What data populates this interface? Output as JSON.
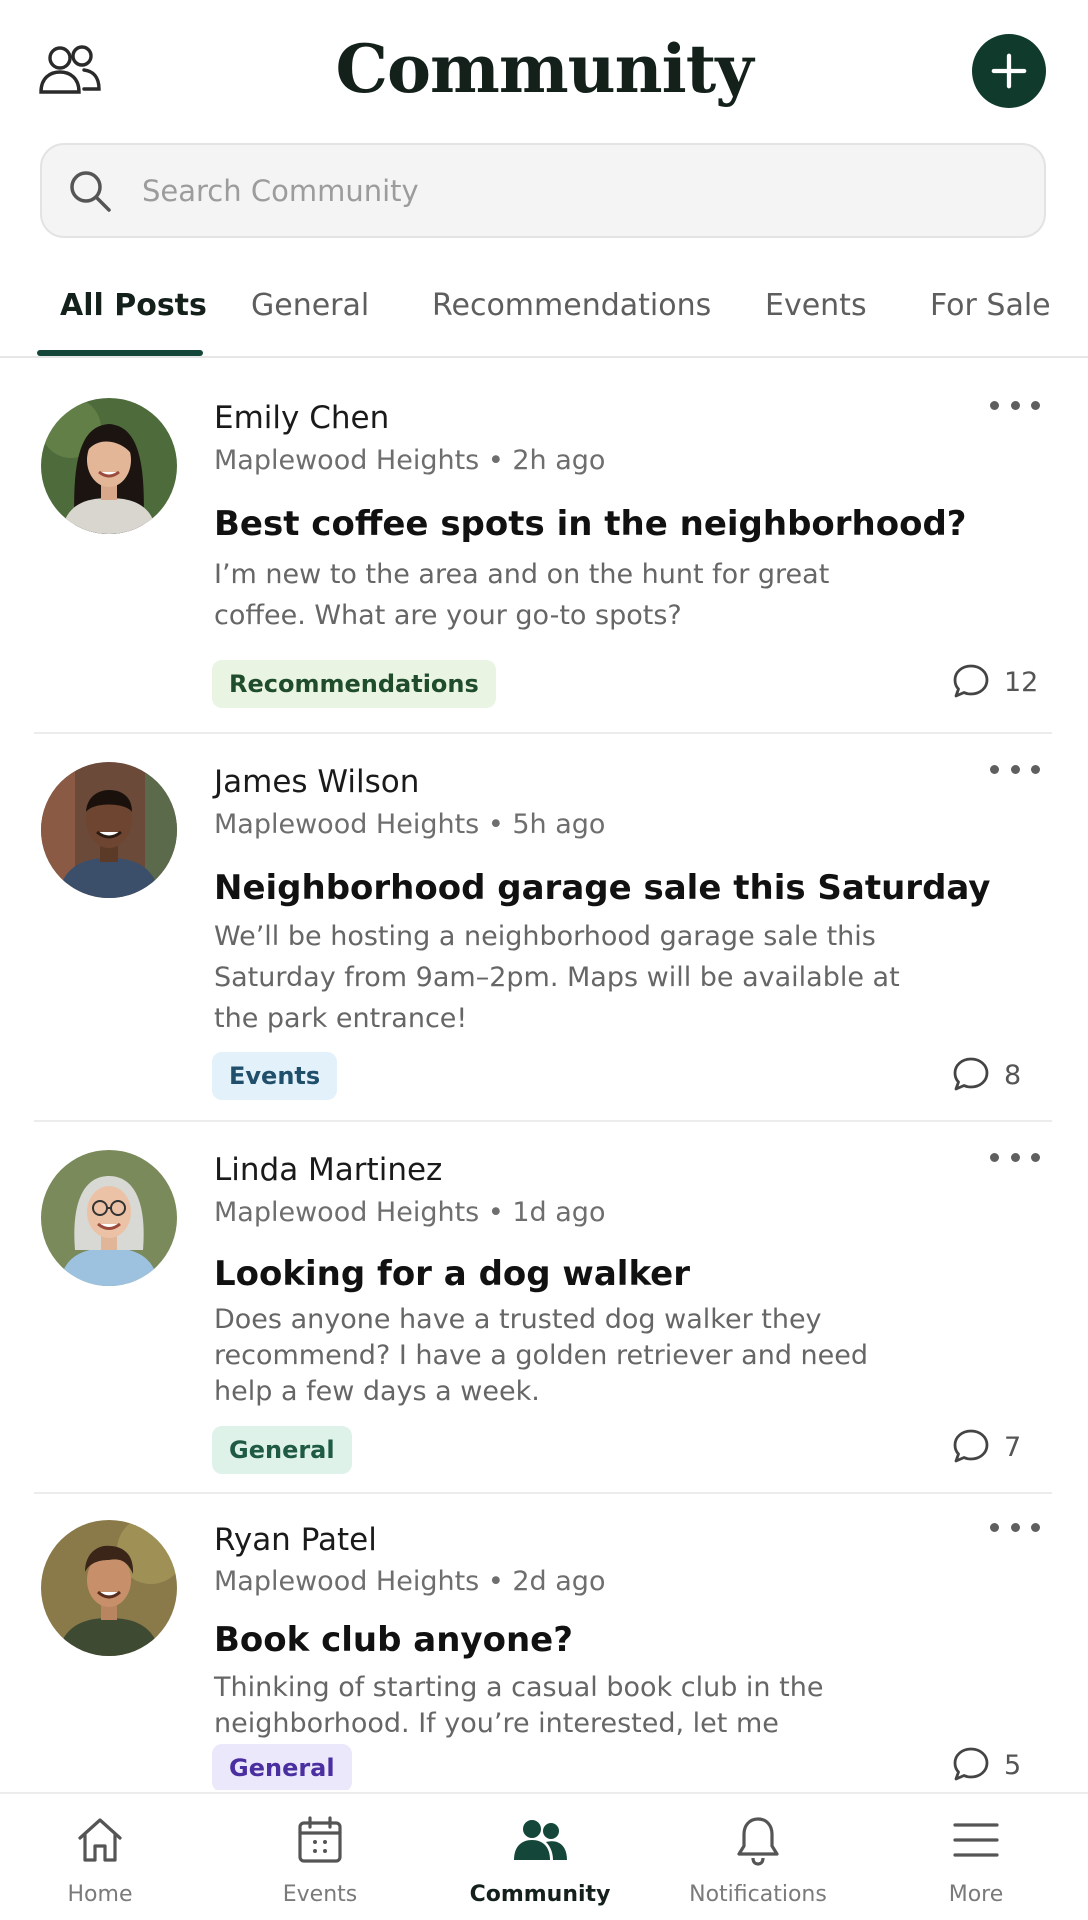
{
  "header": {
    "title": "Community",
    "people_icon": "people-outline-icon",
    "add_icon": "plus-icon"
  },
  "search": {
    "placeholder": "Search Community",
    "icon": "search-icon"
  },
  "tabs": [
    {
      "label": "All Posts",
      "active": true
    },
    {
      "label": "General",
      "active": false
    },
    {
      "label": "Recommendations",
      "active": false
    },
    {
      "label": "Events",
      "active": false
    },
    {
      "label": "For Sale",
      "active": false
    }
  ],
  "posts": [
    {
      "author": "Emily Chen",
      "location": "Maplewood Heights",
      "time": "2h ago",
      "title": "Best coffee spots in the neighborhood?",
      "body": "I’m new to the area and on the hunt for great coffee. What are your go-to spots?",
      "tag": "Recommendations",
      "comments": "12"
    },
    {
      "author": "James Wilson",
      "location": "Maplewood Heights",
      "time": "5h ago",
      "title": "Neighborhood garage sale this Saturday",
      "body": "We’ll be hosting a neighborhood garage sale this Saturday from 9am–2pm. Maps will be available at the park entrance!",
      "tag": "Events",
      "comments": "8"
    },
    {
      "author": "Linda Martinez",
      "location": "Maplewood Heights",
      "time": "1d ago",
      "title": "Looking for a dog walker",
      "body": "Does anyone have a trusted dog walker they recommend? I have a golden retriever and need help a few days a week.",
      "tag": "General",
      "comments": "7"
    },
    {
      "author": "Ryan Patel",
      "location": "Maplewood Heights",
      "time": "2d ago",
      "title": "Book club anyone?",
      "body": "Thinking of starting a casual book club in the neighborhood. If you’re interested, let me know!",
      "tag": "General",
      "comments": "5"
    }
  ],
  "colors": {
    "brand_dark_green": "#0f3a2c",
    "tag_recommendations_bg": "#eaf4e2",
    "tag_recommendations_fg": "#1f4d2c",
    "tag_events_bg": "#e3f1fb",
    "tag_events_fg": "#1f4f6b",
    "tag_general_bg": "#dff2ea",
    "tag_general_fg": "#1e5a44",
    "tag_general_alt_bg": "#ece8fb",
    "tag_general_alt_fg": "#4a2fa0"
  },
  "bottom_nav": [
    {
      "label": "Home",
      "icon": "home-icon",
      "active": false
    },
    {
      "label": "Events",
      "icon": "calendar-icon",
      "active": false
    },
    {
      "label": "Community",
      "icon": "community-icon",
      "active": true
    },
    {
      "label": "Notifications",
      "icon": "bell-icon",
      "active": false
    },
    {
      "label": "More",
      "icon": "menu-icon",
      "active": false
    }
  ]
}
